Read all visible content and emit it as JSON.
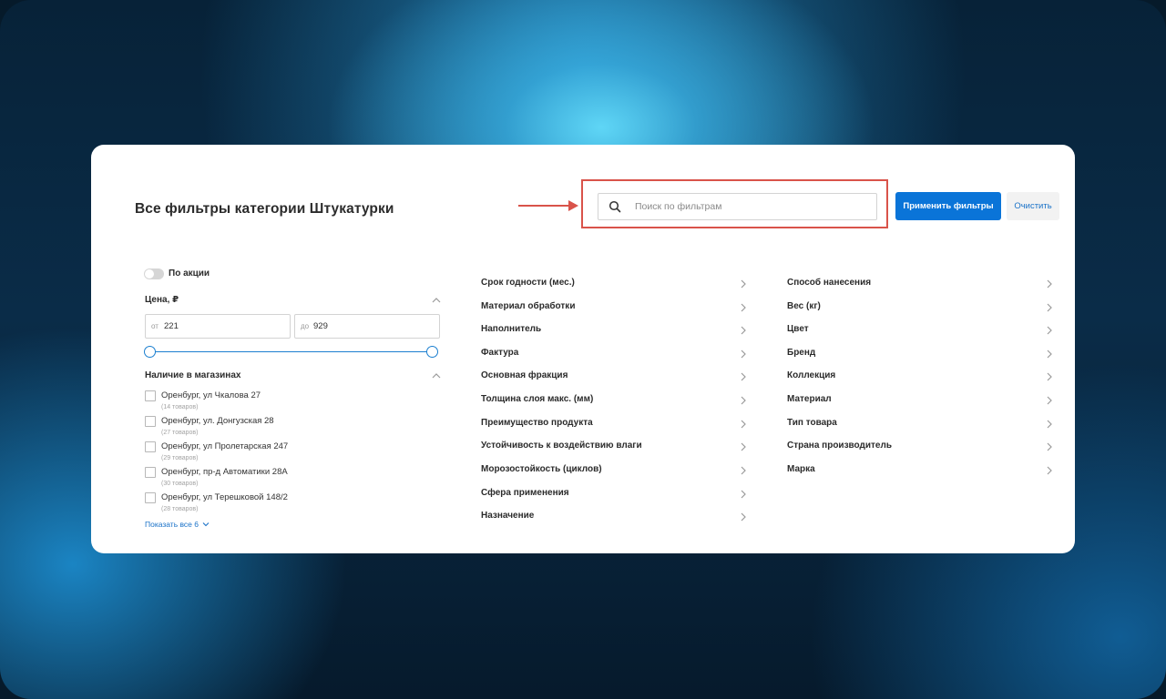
{
  "header": {
    "title": "Все фильтры категории Штукатурки",
    "search_placeholder": "Поиск по фильтрам",
    "apply_label": "Применить фильтры",
    "clear_label": "Очистить"
  },
  "promo_toggle": {
    "label": "По акции",
    "on": false
  },
  "price": {
    "title": "Цена, ₽",
    "from_prefix": "от",
    "from_value": "221",
    "to_prefix": "до",
    "to_value": "929"
  },
  "stores": {
    "title": "Наличие в магазинах",
    "items": [
      {
        "name": "Оренбург, ул Чкалова 27",
        "count": "(14 товаров)"
      },
      {
        "name": "Оренбург, ул. Донгузская 28",
        "count": "(27 товаров)"
      },
      {
        "name": "Оренбург, ул Пролетарская 247",
        "count": "(29 товаров)"
      },
      {
        "name": "Оренбург, пр-д Автоматики 28А",
        "count": "(30 товаров)"
      },
      {
        "name": "Оренбург, ул Терешковой 148/2",
        "count": "(28 товаров)"
      }
    ],
    "show_all": "Показать все 6"
  },
  "filters_mid": [
    "Срок годности (мес.)",
    "Материал обработки",
    "Наполнитель",
    "Фактура",
    "Основная фракция",
    "Толщина слоя макс. (мм)",
    "Преимущество продукта",
    "Устойчивость к воздействию влаги",
    "Морозостойкость (циклов)",
    "Сфера применения",
    "Назначение"
  ],
  "filters_right": [
    "Способ нанесения",
    "Вес (кг)",
    "Цвет",
    "Бренд",
    "Коллекция",
    "Материал",
    "Тип товара",
    "Страна производитель",
    "Марка"
  ],
  "colors": {
    "accent": "#0a74d8",
    "highlight": "#d9534a",
    "link": "#1a72c8"
  }
}
